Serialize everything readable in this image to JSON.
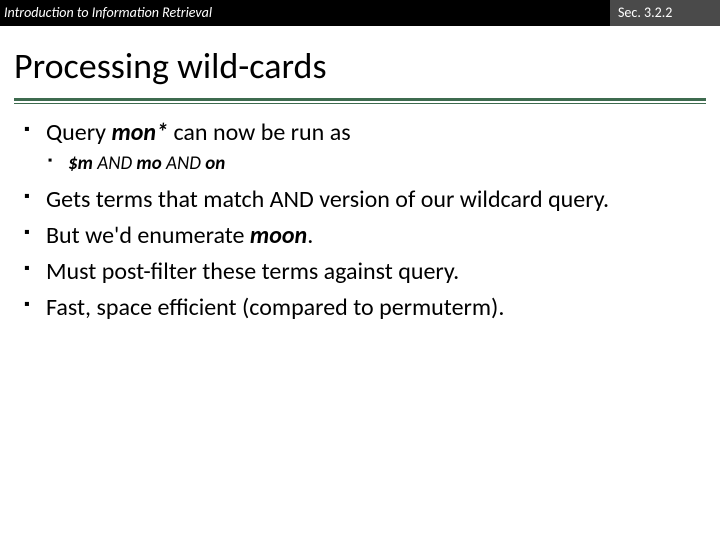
{
  "header": {
    "left": "Introduction to Information Retrieval",
    "right": "Sec. 3.2.2"
  },
  "title": "Processing wild-cards",
  "bullets": {
    "b1_pre": "Query ",
    "b1_bold": "mon*",
    "b1_post": " can now be run as",
    "b1_sub_pre": "$m ",
    "b1_sub_and1": "AND",
    "b1_sub_mid": " mo ",
    "b1_sub_and2": "AND",
    "b1_sub_post": " on",
    "b2": "Gets terms that match AND version of our wildcard query.",
    "b3_pre": "But we'd enumerate ",
    "b3_bold": "moon",
    "b3_post": ".",
    "b4": "Must post-filter these terms against query.",
    "b5": "Fast, space efficient (compared to permuterm)."
  }
}
